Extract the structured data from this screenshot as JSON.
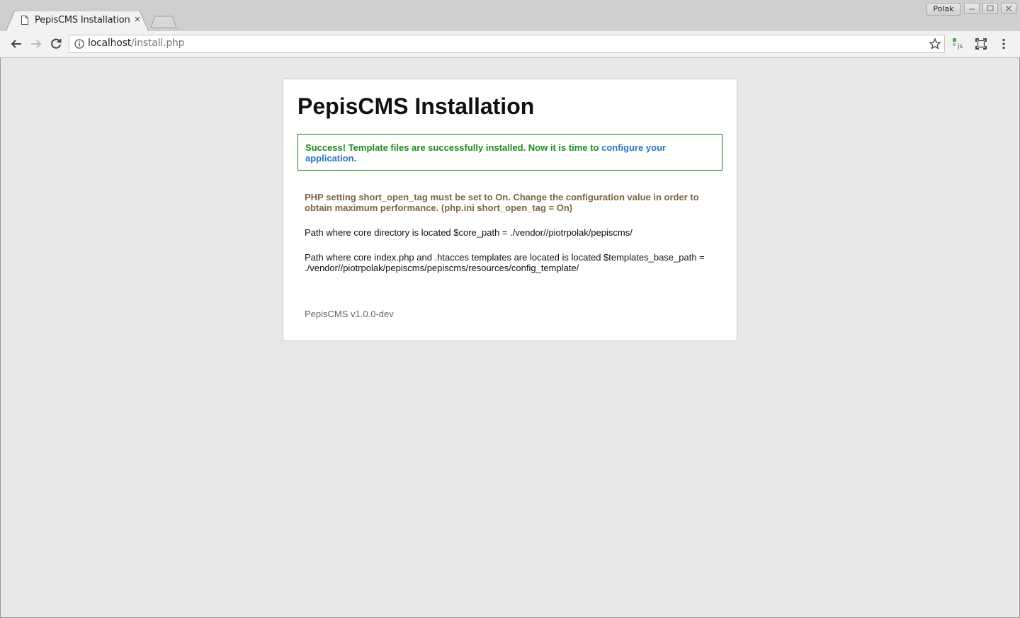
{
  "browser": {
    "tab_title": "PepisCMS Installation",
    "tab_close": "×",
    "profile": "Polak",
    "url_host": "localhost",
    "url_path": "/install.php"
  },
  "page": {
    "heading": "PepisCMS Installation",
    "success_text": "Success! Template files are successfully installed. Now it is time to",
    "success_link": "configure your application",
    "success_end": ".",
    "warning": "PHP setting short_open_tag must be set to On. Change the configuration value in order to obtain maximum performance. (php.ini short_open_tag = On)",
    "core_path_info": "Path where core directory is located $core_path = ./vendor//piotrpolak/pepiscms/",
    "templates_path_info": "Path where core index.php and .htacces templates are located is located $templates_base_path = ./vendor//piotrpolak/pepiscms/pepiscms/resources/config_template/",
    "version": "PepisCMS v1.0.0-dev"
  },
  "colors": {
    "success_text": "#1b8a1b",
    "success_border": "#1f7a1f",
    "link": "#2a73c7",
    "warning": "#7a6544"
  }
}
